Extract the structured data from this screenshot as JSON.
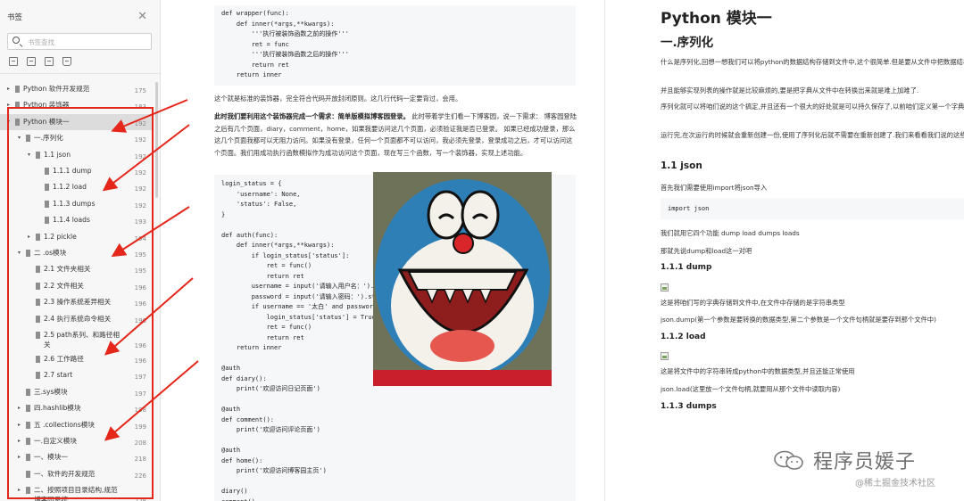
{
  "sidebar": {
    "title": "书签",
    "close_icon": "close-icon",
    "search_placeholder": "书签查找",
    "tools": [
      "expand-all-icon",
      "collapse-all-icon",
      "add-bookmark-icon",
      "bookmark-icon"
    ],
    "items": [
      {
        "label": "Python 软件开发规范",
        "page": "175",
        "level": 0,
        "twisty": "▸",
        "selected": false
      },
      {
        "label": "Python 装饰器",
        "page": "183",
        "level": 0,
        "twisty": "▸",
        "selected": false
      },
      {
        "label": "Python 模块一",
        "page": "192",
        "level": 0,
        "twisty": "▾",
        "selected": true
      },
      {
        "label": "一.序列化",
        "page": "192",
        "level": 1,
        "twisty": "▾",
        "selected": false
      },
      {
        "label": "1.1 json",
        "page": "192",
        "level": 2,
        "twisty": "▾",
        "selected": false
      },
      {
        "label": "1.1.1 dump",
        "page": "192",
        "level": 3,
        "twisty": "",
        "selected": false
      },
      {
        "label": "1.1.2 load",
        "page": "192",
        "level": 3,
        "twisty": "",
        "selected": false
      },
      {
        "label": "1.1.3 dumps",
        "page": "192",
        "level": 3,
        "twisty": "",
        "selected": false
      },
      {
        "label": "1.1.4 loads",
        "page": "193",
        "level": 3,
        "twisty": "",
        "selected": false
      },
      {
        "label": "1.2 pickle",
        "page": "194",
        "level": 2,
        "twisty": "▸",
        "selected": false
      },
      {
        "label": "二 .os模块",
        "page": "195",
        "level": 1,
        "twisty": "▾",
        "selected": false
      },
      {
        "label": "2.1 文件夹相关",
        "page": "195",
        "level": 2,
        "twisty": "",
        "selected": false
      },
      {
        "label": "2.2 文件相关",
        "page": "196",
        "level": 2,
        "twisty": "",
        "selected": false
      },
      {
        "label": "2.3 操作系统差异相关",
        "page": "196",
        "level": 2,
        "twisty": "",
        "selected": false
      },
      {
        "label": "2.4 执行系统命令相关",
        "page": "196",
        "level": 2,
        "twisty": "",
        "selected": false
      },
      {
        "label": "2.5 path系列、和路径相",
        "label2": "关",
        "page": "196",
        "level": 2,
        "twisty": "",
        "selected": false
      },
      {
        "label": "2.6 工作路径",
        "page": "196",
        "level": 2,
        "twisty": "",
        "selected": false
      },
      {
        "label": "2.7 start",
        "page": "197",
        "level": 2,
        "twisty": "",
        "selected": false
      },
      {
        "label": "三.sys模块",
        "page": "197",
        "level": 1,
        "twisty": "",
        "selected": false
      },
      {
        "label": "四.hashlib模块",
        "page": "198",
        "level": 1,
        "twisty": "▸",
        "selected": false
      },
      {
        "label": "五 .collections模块",
        "page": "199",
        "level": 1,
        "twisty": "▸",
        "selected": false
      },
      {
        "label": "一.自定义模块",
        "page": "208",
        "level": 1,
        "twisty": "▸",
        "selected": false
      },
      {
        "label": "一、模块一",
        "page": "218",
        "level": 1,
        "twisty": "▸",
        "selected": false
      },
      {
        "label": "一、软件的开发规范",
        "page": "226",
        "level": 1,
        "twisty": "",
        "selected": false
      },
      {
        "label": "二、按照项目目录结构,规范",
        "label2": "博客园系统",
        "page": "228",
        "level": 1,
        "twisty": "▸",
        "selected": false
      }
    ]
  },
  "middle": {
    "code1": [
      "def wrapper(func):",
      "    def inner(*args,**kwargs):",
      "        '''执行被装饰函数之前的操作'''",
      "        ret = func",
      "        '''执行被装饰函数之后的操作'''",
      "        return ret",
      "    return inner"
    ],
    "para1": "这个就是标准的装饰器，完全符合代码开放封闭原则。这几行代码一定要背过，会用。",
    "para2_bold": "此时我们要利用这个装饰器完成一个需求：简单版模拟博客园登录。",
    "para2_rest": " 此时带着学生们看一下博客园，说一下需求： 博客园登陆之后有几个页面，diary，comment，home，如果我要访问这几个页面，必须验证我是否已登录。 如果已经成功登录，那么这几个页面我都可以无阻力访问。如果没有登录，任何一个页面都不可以访问，我必须先登录，登录成功之后，才可以访问这个页面。我们用成功执行函数模拟作为成功访问这个页面，现在写三个函数，写一个装饰器，实现上述功能。",
    "code2": [
      "login_status = {",
      "    'username': None,",
      "    'status': False,",
      "}",
      "",
      "def auth(func):",
      "    def inner(*args,**kwargs):",
      "        if login_status['status']:",
      "            ret = func()",
      "            return ret",
      "        username = input('请输入用户名：').strip()",
      "        password = input('请输入密码：').strip()",
      "        if username == '太白' and password == '123':",
      "            login_status['status'] = True",
      "            ret = func()",
      "            return ret",
      "    return inner",
      "",
      "@auth",
      "def diary():",
      "    print('欢迎访问日记页面')",
      "",
      "@auth",
      "def comment():",
      "    print('欢迎访问评论页面')",
      "",
      "@auth",
      "def home():",
      "    print('欢迎访问博客园主页')",
      "",
      "diary()",
      "comment()"
    ]
  },
  "article": {
    "h1": "Python 模块一",
    "h2": "一.序列化",
    "p1": "什么是序列化,回想一想我们可以将python的数据结构存储到文件中,这个很简单.但是要从文件中把数据结构转换出来",
    "p2": "并且能够实现列表的操作就是比较麻烦的,要是把字典从文件中在转换出来就是难上加难了.",
    "p3": "序列化就可以将咱们说的这个搞定,并且还有一个很大的好处就是可以持久保存了,以前咱们定义第一个字典当程序",
    "p4": "运行完,在次运行的时候就会重新创建一份,使用了序列化后就不需要在重新创建了.我们来看看我们说的这些怎么用啊",
    "h3_json": "1.1 json",
    "p5": "首先我们需要使用import将json导入",
    "code": "import json",
    "p6": "我们就用它四个功能 dump load dumps loads",
    "p7": "那就先说dump和load这一对吧",
    "h4_dump": "1.1.1 dump",
    "p8": "这是将咱们写的字典存储到文件中,在文件中存储的是字符串类型",
    "p9": "json.dump(第一个参数是要转换的数据类型,第二个参数是一个文件句柄就是要存到那个文件中)",
    "h4_load": "1.1.2 load",
    "p10": "这是将文件中的字符串转成python中的数据类型,并且还能正常使用",
    "p11": "json.load(这里放一个文件句柄,就要用从那个文件中读取内容)",
    "h4_dumps": "1.1.3 dumps"
  },
  "watermark": {
    "brand": "程序员媛子",
    "sub": "@稀土掘金技术社区",
    "icon": "wechat-icon"
  },
  "image": {
    "subject": "doraemon-laughing"
  },
  "colors": {
    "annotation": "#e5261a",
    "code_bg": "#f6f7f9",
    "sidebar_bg": "#f7f7f7",
    "selected_row": "#dcdcdc"
  }
}
